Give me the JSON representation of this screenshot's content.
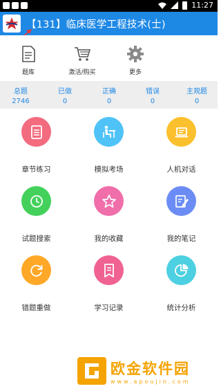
{
  "status_bar": {
    "time": "11:27"
  },
  "app_bar": {
    "title": "【131】临床医学工程技术(士)"
  },
  "toolbar": [
    {
      "label": "题库",
      "icon": "document-icon"
    },
    {
      "label": "激活/购买",
      "icon": "cart-icon"
    },
    {
      "label": "更多",
      "icon": "gear-icon"
    }
  ],
  "stats": [
    {
      "label": "总题",
      "value": "2746"
    },
    {
      "label": "已做",
      "value": "0"
    },
    {
      "label": "正确",
      "value": "0"
    },
    {
      "label": "错误",
      "value": "0"
    },
    {
      "label": "主观题",
      "value": "0"
    }
  ],
  "grid": [
    {
      "label": "章节练习",
      "color": "#f36b7f",
      "icon": "document-icon"
    },
    {
      "label": "模拟考场",
      "color": "#4fc3f7",
      "icon": "exam-desk-icon"
    },
    {
      "label": "人机对话",
      "color": "#fbc02d",
      "icon": "laptop-icon"
    },
    {
      "label": "试题搜索",
      "color": "#43d15b",
      "icon": "clock-icon"
    },
    {
      "label": "我的收藏",
      "color": "#f06eaa",
      "icon": "star-icon"
    },
    {
      "label": "我的笔记",
      "color": "#6c8cf5",
      "icon": "note-icon"
    },
    {
      "label": "错题重做",
      "color": "#ffa726",
      "icon": "redo-icon"
    },
    {
      "label": "学习记录",
      "color": "#f06292",
      "icon": "bookmark-icon"
    },
    {
      "label": "统计分析",
      "color": "#4dd0e1",
      "icon": "pie-chart-icon"
    }
  ],
  "watermark": {
    "title": "欧金软件园",
    "subtitle": "www.apoujin.com"
  },
  "colors": {
    "primary": "#1e88e5",
    "stats_bg": "#eeeeee",
    "accent_orange": "#f4a300",
    "arrow_red": "#e53935"
  }
}
